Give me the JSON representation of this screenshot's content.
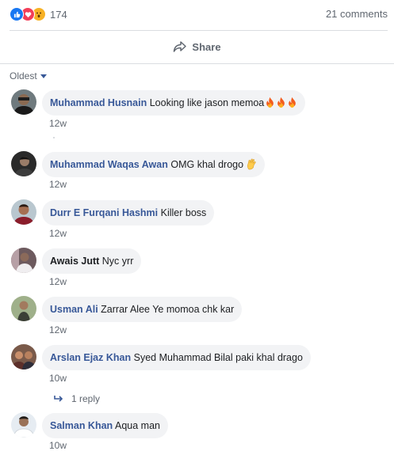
{
  "stats": {
    "reaction_count": "174",
    "comment_count": "21 comments",
    "reactions": [
      "like-icon",
      "love-icon",
      "wow-icon"
    ]
  },
  "actions": {
    "share_label": "Share"
  },
  "sort": {
    "label": "Oldest"
  },
  "comments": [
    {
      "author": "Muhammad Husnain",
      "text": "Looking like jason memoa",
      "emoji": "fire x3",
      "time": "12w"
    },
    {
      "author": "Muhammad Waqas Awan",
      "text": "OMG khal drogo",
      "emoji": "ok-hand",
      "time": "12w"
    },
    {
      "author": "Durr E Furqani Hashmi",
      "text": "Killer boss",
      "time": "12w"
    },
    {
      "author": "Awais Jutt",
      "text": "Nyc yrr",
      "time": "12w"
    },
    {
      "author": "Usman Ali",
      "text": "Zarrar Alee Ye momoa chk kar",
      "time": "12w"
    },
    {
      "author": "Arslan Ejaz Khan",
      "text": "Syed Muhammad Bilal paki khal drago",
      "time": "10w"
    },
    {
      "author": "Salman Khan",
      "text": "Aqua man",
      "time": "10w"
    }
  ],
  "replies": {
    "label": "1 reply"
  },
  "colors": {
    "link": "#385898",
    "bubble": "#f2f3f5",
    "meta": "#606770",
    "like": "#1877f2",
    "love": "#f33e58",
    "wow": "#f7b125"
  }
}
